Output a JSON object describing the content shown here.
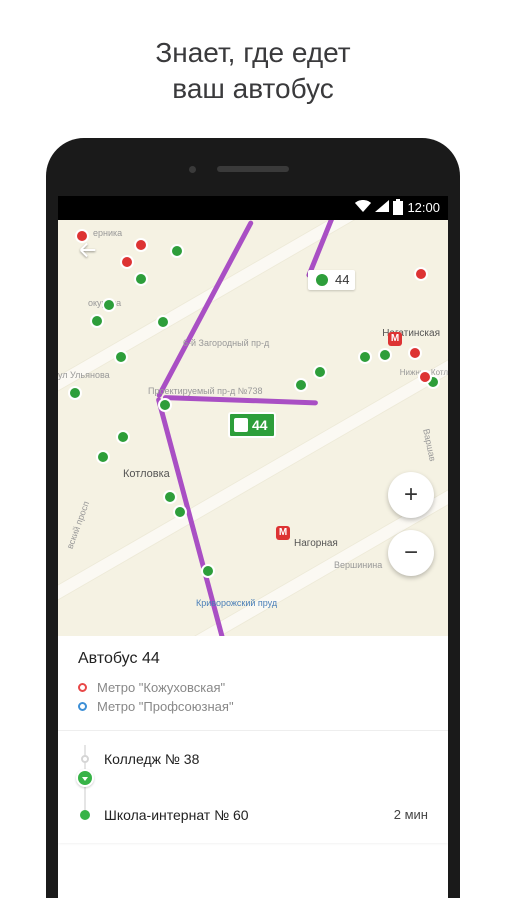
{
  "headline_line1": "Знает, где едет",
  "headline_line2": "ваш автобус",
  "status_bar": {
    "time": "12:00"
  },
  "map": {
    "stop_label_44": "44",
    "bus_badge_44": "44",
    "labels": {
      "kotlovka": "Котловка",
      "nagatinskaya": "Нагатинская",
      "nizhnie_kotl": "Нижние Котл",
      "nagornaya": "Нагорная",
      "vershinina": "Вершинина",
      "krivorozhskii_prud": "Криворожский пруд",
      "zagorodnyi": "6-й Загородный пр-д",
      "proektiruemyi": "Проектируемый пр-д №738",
      "ulyanova": "ул Ульянова",
      "okurova": "окурова",
      "varshav": "Варшав",
      "ernika": "ерника",
      "vskii_prosp": "вский просп"
    },
    "zoom_plus": "+",
    "zoom_minus": "−"
  },
  "panel": {
    "title": "Автобус 44",
    "endpoint_a": "Метро \"Кожуховская\"",
    "endpoint_b": "Метро \"Профсоюзная\""
  },
  "stops": {
    "item0": {
      "name": "Колледж № 38"
    },
    "item1": {
      "name": "Школа-интернат № 60",
      "eta": "2 мин"
    }
  }
}
